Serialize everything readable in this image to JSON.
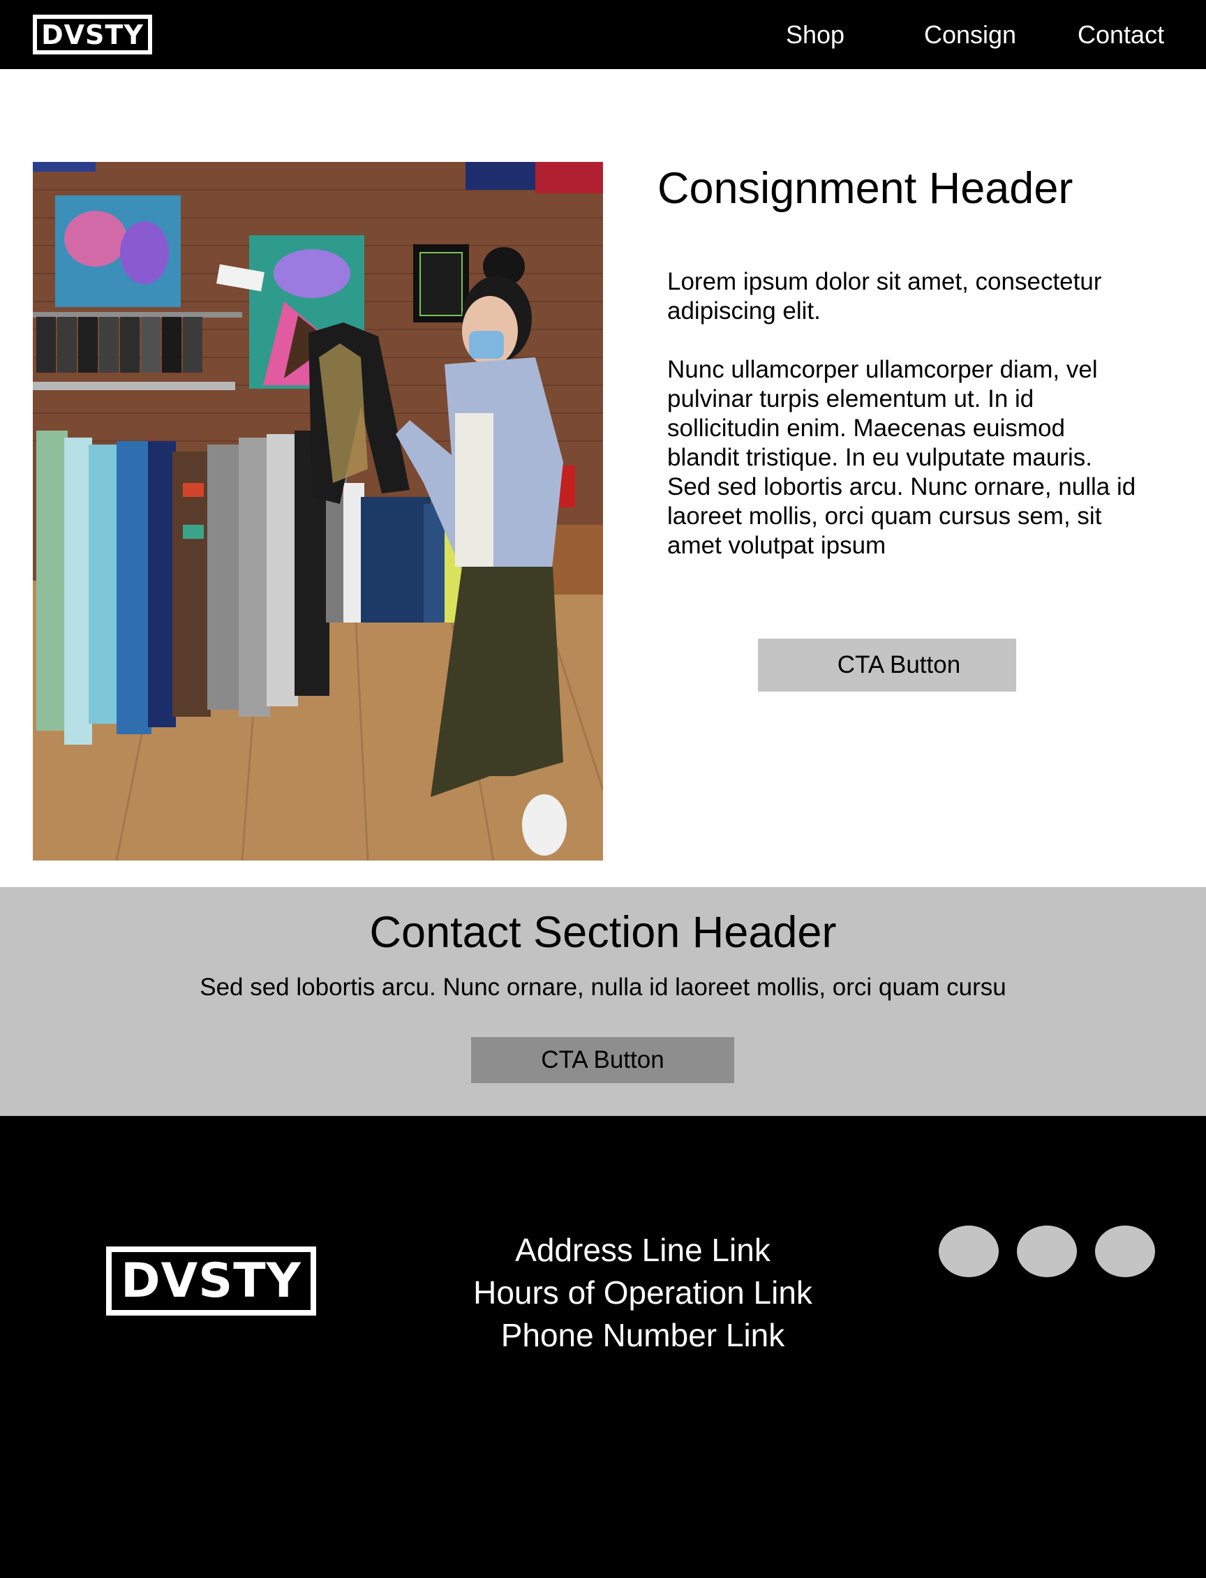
{
  "header": {
    "logo_text": "DVSTY",
    "nav": {
      "shop": "Shop",
      "consign": "Consign",
      "contact": "Contact"
    }
  },
  "hero": {
    "image": "clothing-store-photo",
    "header": "Consignment Header",
    "paragraphs": [
      "Lorem ipsum dolor sit amet, consectetur adipiscing elit.",
      "Nunc ullamcorper ullamcorper diam, vel pulvinar turpis elementum ut. In id sollicitudin enim. Maecenas euismod blandit tristique. In eu vulputate mauris. Sed sed lobortis arcu. Nunc ornare, nulla id laoreet mollis, orci quam cursus sem, sit amet volutpat ipsum"
    ],
    "cta_label": "CTA Button"
  },
  "contact": {
    "header": "Contact Section Header",
    "text": "Sed sed lobortis arcu. Nunc ornare, nulla id laoreet mollis, orci quam cursu",
    "cta_label": "CTA Button",
    "colors": {
      "background": "#c2c2c2",
      "button": "#8e8e8e"
    }
  },
  "footer": {
    "logo_text": "DVSTY",
    "links": {
      "address": "Address Line Link",
      "hours": "Hours of Operation Link",
      "phone": "Phone Number Link"
    },
    "social_icons": [
      "social-icon",
      "social-icon",
      "social-icon"
    ]
  },
  "colors": {
    "nav_bg": "#000000",
    "footer_bg": "#000000",
    "cta_bg": "#c4c4c4"
  }
}
